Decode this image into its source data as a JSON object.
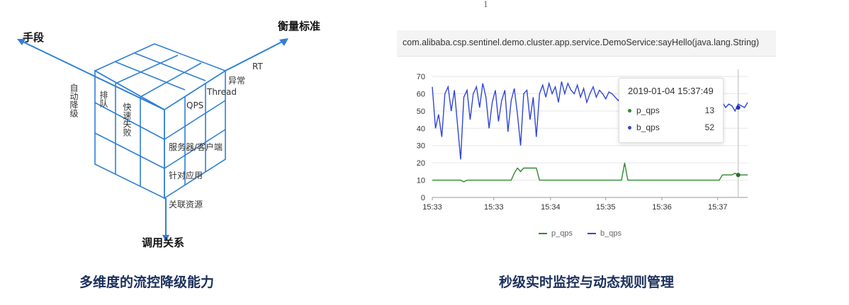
{
  "page_number": "1",
  "left": {
    "axes": {
      "means": "手段",
      "metrics": "衡量标准",
      "relation": "调用关系"
    },
    "front_labels": {
      "auto_degrade": "自动降级",
      "queue": "排队",
      "fail_fast": "快速失败"
    },
    "top_labels": {
      "rt": "RT",
      "exception": "异常",
      "thread": "Thread",
      "qps": "QPS"
    },
    "side_labels": {
      "server_client": "服务器/客户端",
      "per_app": "针对应用",
      "related_resource": "关联资源"
    },
    "caption": "多维度的流控降级能力"
  },
  "right": {
    "chart_title": "com.alibaba.csp.sentinel.demo.cluster.app.service.DemoService:sayHello(java.lang.String)",
    "tooltip": {
      "time": "2019-01-04 15:37:49",
      "rows": [
        {
          "name": "p_qps",
          "value": "13",
          "color": "#2f8a2f"
        },
        {
          "name": "b_qps",
          "value": "52",
          "color": "#3046d6"
        }
      ]
    },
    "caption": "秒级实时监控与动态规则管理"
  },
  "chart_data": {
    "type": "line",
    "x_ticks": [
      "15:33",
      "15:33",
      "15:34",
      "15:35",
      "15:36",
      "15:37"
    ],
    "y_ticks": [
      "0",
      "10",
      "20",
      "30",
      "40",
      "50",
      "60",
      "70"
    ],
    "ylim": [
      0,
      70
    ],
    "legend": "bottom",
    "series": [
      {
        "name": "p_qps",
        "color": "#2f8a2f",
        "x": [
          0,
          5,
          6,
          7,
          8,
          9,
          10,
          11,
          12,
          13,
          14,
          15,
          16,
          17,
          18,
          19,
          20,
          21,
          22,
          23,
          24,
          25,
          26,
          27,
          28,
          29,
          30,
          31,
          32,
          33,
          34,
          35,
          36,
          37,
          38,
          39,
          40,
          41,
          42,
          43,
          44,
          45,
          46,
          47,
          48,
          49,
          50,
          51,
          52,
          53,
          54,
          55,
          56,
          57,
          58,
          59,
          60,
          61,
          62,
          63,
          64,
          65,
          66,
          67,
          68,
          69,
          70,
          71,
          72,
          73,
          74,
          75,
          76,
          77,
          78,
          79,
          80,
          81,
          82,
          83,
          84,
          85,
          86,
          87,
          88,
          89,
          90,
          91,
          92,
          93,
          94,
          95,
          96,
          97,
          98,
          99,
          100
        ],
        "y": [
          10,
          10,
          10,
          10,
          10,
          10,
          9,
          10,
          10,
          10,
          10,
          10,
          10,
          10,
          10,
          10,
          10,
          10,
          10,
          10,
          10,
          10,
          14,
          17,
          15,
          17,
          17,
          17,
          17,
          17,
          10,
          10,
          10,
          10,
          10,
          10,
          10,
          10,
          10,
          10,
          10,
          10,
          10,
          10,
          10,
          10,
          10,
          10,
          10,
          10,
          10,
          10,
          10,
          10,
          10,
          10,
          10,
          20,
          10,
          10,
          10,
          10,
          10,
          10,
          10,
          10,
          10,
          10,
          10,
          10,
          10,
          10,
          10,
          10,
          10,
          10,
          10,
          10,
          10,
          10,
          10,
          10,
          10,
          10,
          10,
          10,
          10,
          10,
          13,
          13,
          13,
          13,
          14,
          13,
          13,
          13,
          13
        ]
      },
      {
        "name": "b_qps",
        "color": "#3046d6",
        "x": [
          0,
          1,
          2,
          3,
          4,
          5,
          6,
          7,
          8,
          9,
          10,
          11,
          12,
          13,
          14,
          15,
          16,
          17,
          18,
          19,
          20,
          21,
          22,
          23,
          24,
          25,
          26,
          27,
          28,
          29,
          30,
          31,
          32,
          33,
          34,
          35,
          36,
          37,
          38,
          39,
          40,
          41,
          42,
          43,
          44,
          45,
          46,
          47,
          48,
          49,
          50,
          51,
          52,
          53,
          54,
          55,
          56,
          57,
          58,
          59,
          60,
          61,
          62,
          63,
          64,
          65,
          66,
          67,
          68,
          69,
          70,
          71,
          72,
          73,
          74,
          75,
          76,
          77,
          78,
          79,
          80,
          81,
          82,
          83,
          84,
          85,
          86,
          87,
          88,
          89,
          90,
          91,
          92,
          93,
          94,
          95,
          96,
          97,
          98,
          99,
          100
        ],
        "y": [
          64,
          40,
          48,
          35,
          60,
          64,
          50,
          62,
          42,
          22,
          58,
          62,
          45,
          60,
          64,
          52,
          66,
          58,
          40,
          55,
          62,
          44,
          56,
          62,
          38,
          56,
          63,
          48,
          30,
          60,
          62,
          45,
          58,
          35,
          60,
          65,
          58,
          66,
          60,
          64,
          55,
          67,
          60,
          66,
          62,
          60,
          65,
          58,
          63,
          55,
          60,
          64,
          58,
          62,
          60,
          57,
          61,
          60,
          58,
          56,
          60,
          57,
          58,
          55,
          57,
          56,
          58,
          55,
          57,
          54,
          56,
          55,
          57,
          53,
          56,
          55,
          54,
          56,
          53,
          55,
          54,
          56,
          53,
          55,
          52,
          54,
          53,
          55,
          52,
          54,
          53,
          51,
          55,
          52,
          54,
          53,
          50,
          54,
          53,
          52,
          55
        ]
      }
    ]
  }
}
